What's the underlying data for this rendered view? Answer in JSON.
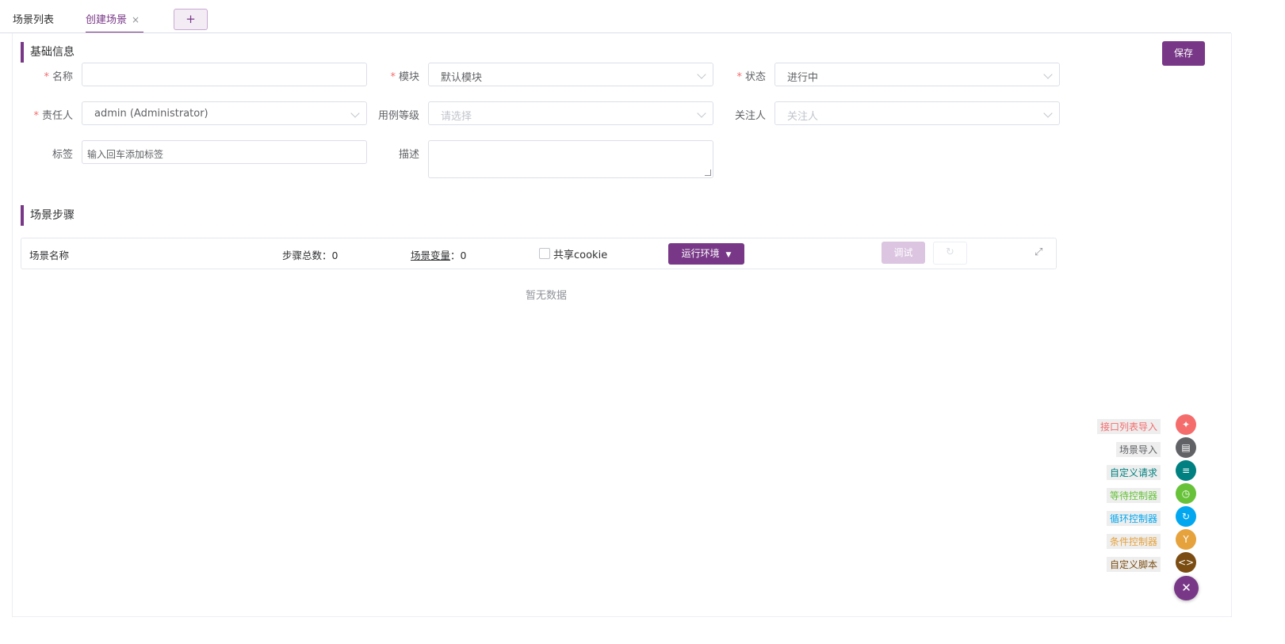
{
  "tabs": {
    "list_label": "场景列表",
    "create_label": "创建场景",
    "close_glyph": "×",
    "add_glyph": "+"
  },
  "basic": {
    "title": "基础信息",
    "save_label": "保存",
    "name_label": "名称",
    "module_label": "模块",
    "module_value": "默认模块",
    "status_label": "状态",
    "status_value": "进行中",
    "owner_label": "责任人",
    "owner_value": "admin (Administrator)",
    "level_label": "用例等级",
    "level_placeholder": "请选择",
    "follow_label": "关注人",
    "follow_placeholder": "关注人",
    "tags_label": "标签",
    "tags_placeholder": "输入回车添加标签",
    "desc_label": "描述",
    "required_mark": "*"
  },
  "steps": {
    "title": "场景步骤",
    "scenario_name": "场景名称",
    "total_label": "步骤总数：",
    "total_value": "0",
    "vars_label": "场景变量",
    "vars_sep": "：",
    "vars_value": "0",
    "cookie_label": "共享cookie",
    "env_label": "运行环境",
    "debug_label": "调试",
    "empty_text": "暂无数据"
  },
  "tools": [
    {
      "label": "接口列表导入",
      "color": "#f56c6c",
      "icon": "api-import-icon",
      "glyph": "✦"
    },
    {
      "label": "场景导入",
      "color": "#606266",
      "icon": "clapper-icon",
      "glyph": "▤"
    },
    {
      "label": "自定义请求",
      "color": "#008080",
      "icon": "sliders-icon",
      "glyph": "≡"
    },
    {
      "label": "等待控制器",
      "color": "#67c23a",
      "icon": "clock-icon",
      "glyph": "◷"
    },
    {
      "label": "循环控制器",
      "color": "#02a7f0",
      "icon": "loop-icon",
      "glyph": "↻"
    },
    {
      "label": "条件控制器",
      "color": "#e6a23c",
      "icon": "branch-icon",
      "glyph": "Y"
    },
    {
      "label": "自定义脚本",
      "color": "#7b4d12",
      "icon": "code-icon",
      "glyph": "<>"
    }
  ],
  "colors": {
    "accent": "#783887"
  }
}
